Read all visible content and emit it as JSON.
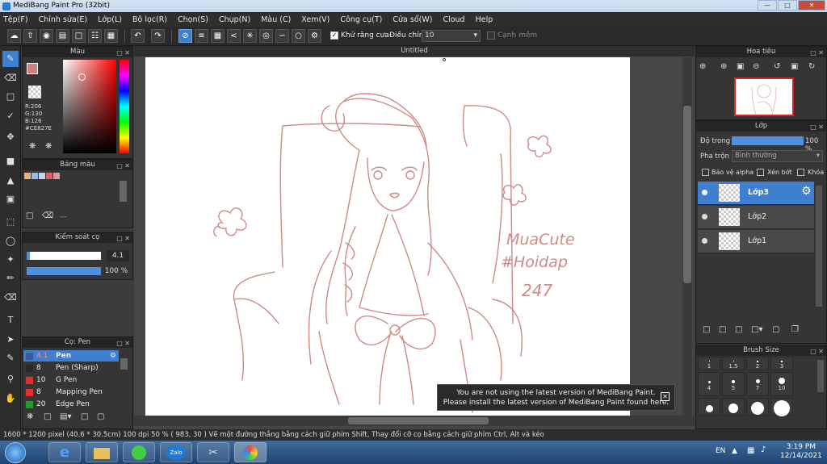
{
  "window": {
    "title": "MediBang Paint Pro (32bit)"
  },
  "menu": [
    "Tệp(F)",
    "Chỉnh sửa(E)",
    "Lớp(L)",
    "Bộ lọc(R)",
    "Chọn(S)",
    "Chụp(N)",
    "Màu (C)",
    "Xem(V)",
    "Công cụ(T)",
    "Cửa sổ(W)",
    "Cloud",
    "Help"
  ],
  "toolbar": {
    "antialias_label": "Khử răng cưa",
    "adjust_label": "Điều chỉnh",
    "adjust_value": "10",
    "edge_label": "Cạnh mềm"
  },
  "color_panel": {
    "title": "Màu",
    "r": "R:206",
    "g": "G:130",
    "b": "B:126",
    "hex": "#CE827E",
    "color": "#CE827E"
  },
  "palette_panel": {
    "title": "Bảng màu",
    "footer": "---",
    "swatches": [
      "#e8b080",
      "#a0b8e0",
      "#c8d0f0",
      "#e06060",
      "#d0a0a0"
    ]
  },
  "brush_control": {
    "title": "Kiểm soát cọ",
    "size": "4.1",
    "opacity": "100 %"
  },
  "brush_panel": {
    "title": "Cọ: Pen",
    "items": [
      {
        "size": "4.1",
        "name": "Pen",
        "color": "#3a5a9a"
      },
      {
        "size": "8",
        "name": "Pen (Sharp)",
        "color": "#2a2a2a"
      },
      {
        "size": "10",
        "name": "G Pen",
        "color": "#e03030"
      },
      {
        "size": "8",
        "name": "Mapping Pen",
        "color": "#e03030"
      },
      {
        "size": "20",
        "name": "Edge Pen",
        "color": "#20a020"
      }
    ]
  },
  "canvas": {
    "title": "Untitled"
  },
  "artwork_text": [
    "MuaCute",
    "#Hoidap",
    "247"
  ],
  "notification": {
    "line1": "You are not using the latest version of MediBang Paint.",
    "line2": "Please install the latest version of MediBang Paint found here."
  },
  "navigator": {
    "title": "Hoa tiêu"
  },
  "layer_panel": {
    "title": "Lớp",
    "opacity_label": "Độ trong",
    "opacity_value": "100 %",
    "blend_label": "Pha trộn",
    "blend_value": "Bình thường",
    "protect_alpha": "Bảo vệ alpha",
    "clipping": "Xén bớt",
    "lock": "Khóa",
    "layers": [
      "Lớp3",
      "Lớp2",
      "Lớp1"
    ]
  },
  "brush_size": {
    "title": "Brush Size",
    "values": [
      "1",
      "1.5",
      "2",
      "3",
      "4",
      "5",
      "7",
      "10"
    ]
  },
  "status": {
    "dimensions": "1600 * 1200 pixel",
    "physical": "(40.6 * 30.5cm)",
    "dpi": "100 dpi",
    "zoom": "50 %",
    "coords": "( 983, 30 )",
    "hint": "Vẽ một đường thẳng bằng cách giữ phím Shift, Thay đổi cỡ cọ bằng cách giữ phím Ctrl, Alt và kéo"
  },
  "taskbar": {
    "lang": "EN",
    "time": "3:19 PM",
    "date": "12/14/2021",
    "zalo": "Zalo"
  }
}
